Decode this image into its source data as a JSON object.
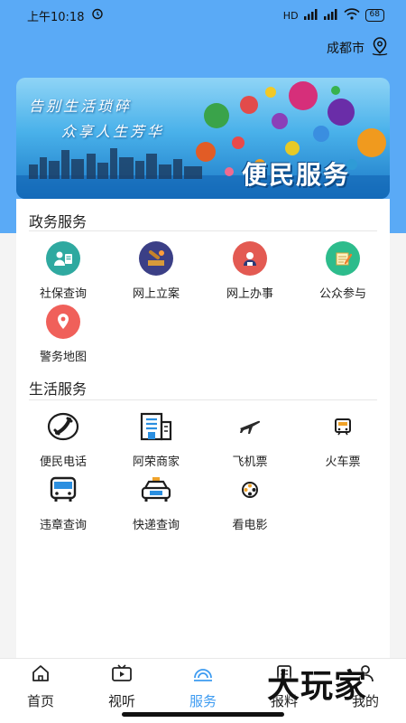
{
  "status_bar": {
    "time": "上午10:18",
    "signal": "HD",
    "battery": "68"
  },
  "header": {
    "city": "成都市"
  },
  "banner": {
    "slogan_line1": "告别生活琐碎",
    "slogan_line2": "众享人生芳华",
    "title": "便民服务"
  },
  "gov_section": {
    "title": "政务服务",
    "items": [
      {
        "label": "社保查询",
        "icon": "social-security-icon"
      },
      {
        "label": "网上立案",
        "icon": "online-filing-icon"
      },
      {
        "label": "网上办事",
        "icon": "online-affairs-icon"
      },
      {
        "label": "公众参与",
        "icon": "public-participation-icon"
      },
      {
        "label": "警务地图",
        "icon": "police-map-icon"
      }
    ]
  },
  "life_section": {
    "title": "生活服务",
    "items": [
      {
        "label": "便民电话",
        "icon": "phone-icon"
      },
      {
        "label": "阿荣商家",
        "icon": "shop-building-icon"
      },
      {
        "label": "飞机票",
        "icon": "airplane-icon"
      },
      {
        "label": "火车票",
        "icon": "train-icon"
      },
      {
        "label": "违章查询",
        "icon": "bus-icon"
      },
      {
        "label": "快递查询",
        "icon": "taxi-icon"
      },
      {
        "label": "看电影",
        "icon": "film-reel-icon"
      }
    ]
  },
  "tabbar": {
    "tabs": [
      {
        "label": "首页",
        "icon": "home-icon"
      },
      {
        "label": "视听",
        "icon": "video-icon"
      },
      {
        "label": "服务",
        "icon": "service-icon",
        "active": true
      },
      {
        "label": "报料",
        "icon": "report-icon"
      },
      {
        "label": "我的",
        "icon": "profile-icon"
      }
    ]
  },
  "watermark": "大玩家",
  "colors": {
    "header_bg": "#5aaaf6",
    "active_tab": "#3d9bf1",
    "card_bg": "#ffffff"
  }
}
